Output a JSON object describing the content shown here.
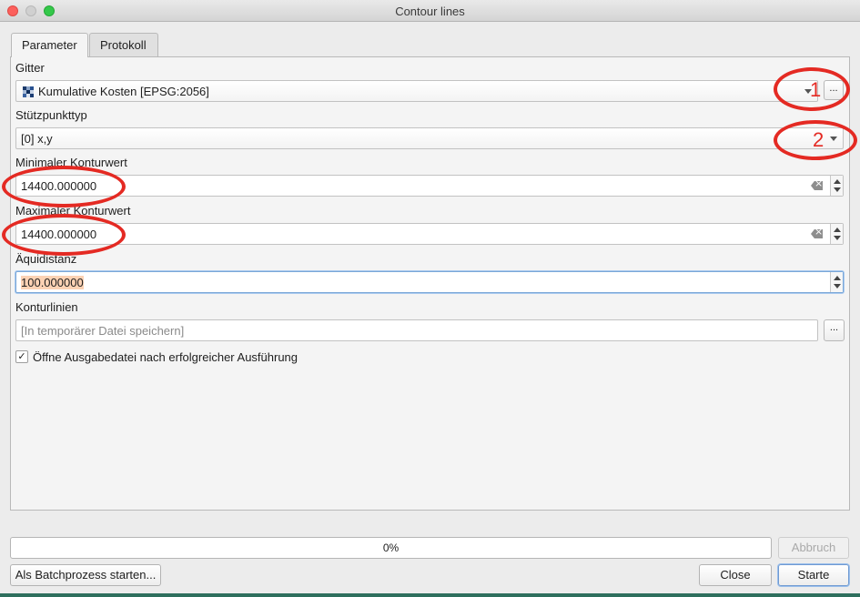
{
  "window": {
    "title": "Contour lines"
  },
  "tabs": [
    {
      "label": "Parameter",
      "active": true
    },
    {
      "label": "Protokoll",
      "active": false
    }
  ],
  "params": {
    "gitter": {
      "label": "Gitter",
      "value": "Kumulative Kosten [EPSG:2056]",
      "icon": "raster-layer-icon"
    },
    "stuetzpunkttyp": {
      "label": "Stützpunkttyp",
      "value": "[0] x,y"
    },
    "min_kontur": {
      "label": "Minimaler Konturwert",
      "value": "14400.000000"
    },
    "max_kontur": {
      "label": "Maximaler Konturwert",
      "value": "14400.000000"
    },
    "aequidistanz": {
      "label": "Äquidistanz",
      "value": "100.000000"
    },
    "konturlinien": {
      "label": "Konturlinien",
      "placeholder": "[In temporärer Datei speichern]"
    },
    "open_output": {
      "label": "Öffne Ausgabedatei nach erfolgreicher Ausführung",
      "checked": true,
      "check_glyph": "✓"
    }
  },
  "buttons": {
    "dots": "...",
    "dots_menu": "...",
    "abbruch": "Abbruch",
    "batch": "Als Batchprozess starten...",
    "close": "Close",
    "starte": "Starte"
  },
  "progress": {
    "value": 0,
    "text": "0%"
  },
  "annotations": {
    "one": "1",
    "two": "2",
    "color": "#e42a23"
  }
}
